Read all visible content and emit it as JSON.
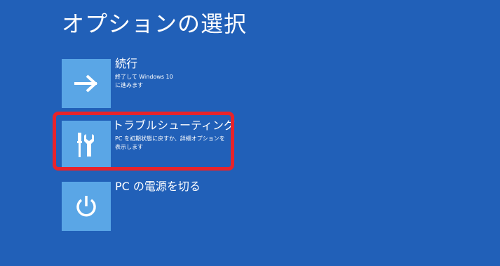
{
  "colors": {
    "background": "#2160b8",
    "tile": "#5aa6e6",
    "text": "#ffffff",
    "highlight": "#e8232a"
  },
  "header": {
    "title": "オプションの選択"
  },
  "options": [
    {
      "icon": "arrow-right-icon",
      "title": "続行",
      "description": [
        "終了して Windows 10",
        "に進みます"
      ]
    },
    {
      "icon": "tools-icon",
      "title": "トラブルシューティング",
      "description": [
        "PC を初期状態に戻すか、詳細オプションを",
        "表示します"
      ],
      "highlighted": true
    },
    {
      "icon": "power-icon",
      "title": "PC の電源を切る",
      "description": []
    }
  ]
}
